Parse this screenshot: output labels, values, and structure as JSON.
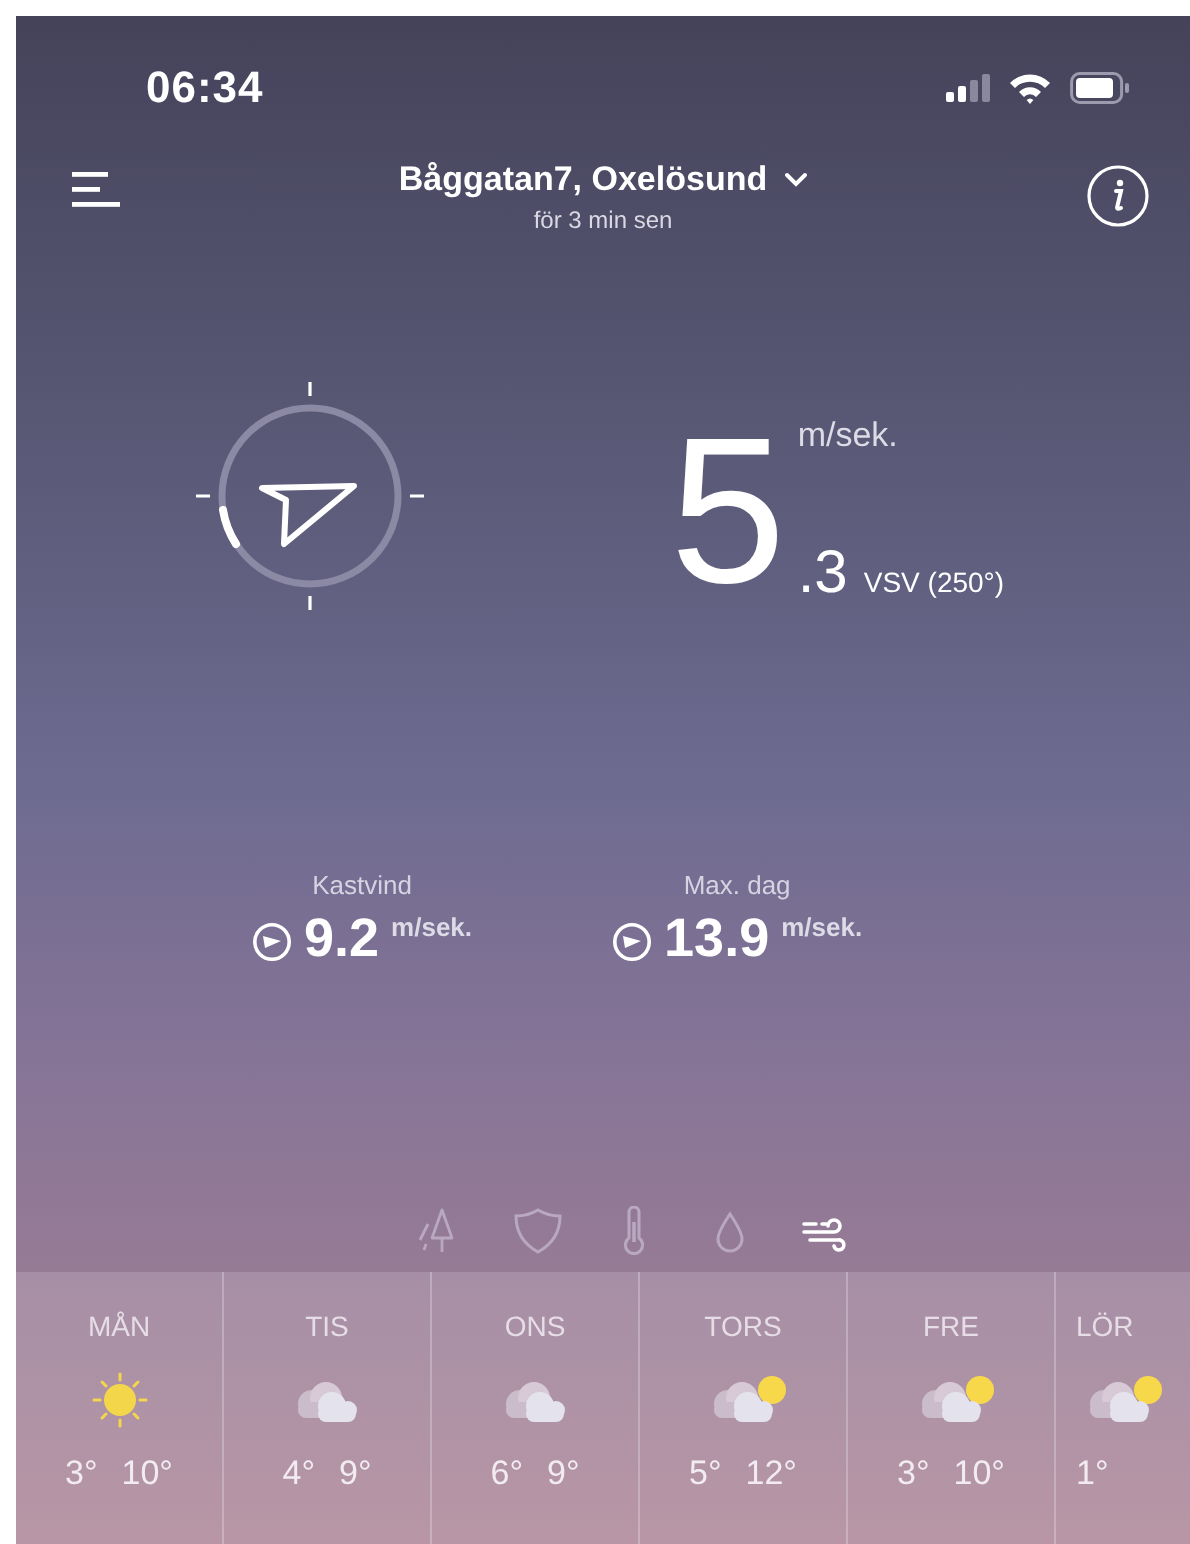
{
  "status_bar": {
    "time": "06:34"
  },
  "header": {
    "location": "Båggatan7, Oxelösund",
    "updated": "för 3 min sen"
  },
  "wind": {
    "speed_whole": "5",
    "speed_decimal": ".3",
    "unit": "m/sek.",
    "direction": "VSV (250°)"
  },
  "stats": [
    {
      "label": "Kastvind",
      "value": "9.2",
      "unit": "m/sek."
    },
    {
      "label": "Max. dag",
      "value": "13.9",
      "unit": "m/sek."
    }
  ],
  "modes": [
    {
      "kind": "tree",
      "selected": false
    },
    {
      "kind": "shield",
      "selected": false
    },
    {
      "kind": "thermometer",
      "selected": false
    },
    {
      "kind": "drop",
      "selected": false
    },
    {
      "kind": "wind",
      "selected": true
    }
  ],
  "forecast": [
    {
      "day": "MÅN",
      "kind": "sun",
      "low": "3°",
      "high": "10°"
    },
    {
      "day": "TIS",
      "kind": "cloud",
      "low": "4°",
      "high": "9°"
    },
    {
      "day": "ONS",
      "kind": "cloud",
      "low": "6°",
      "high": "9°"
    },
    {
      "day": "TORS",
      "kind": "cloud-sun",
      "low": "5°",
      "high": "12°"
    },
    {
      "day": "FRE",
      "kind": "cloud-sun",
      "low": "3°",
      "high": "10°"
    },
    {
      "day": "LÖR",
      "kind": "cloud-sun",
      "low": "1°"
    }
  ]
}
